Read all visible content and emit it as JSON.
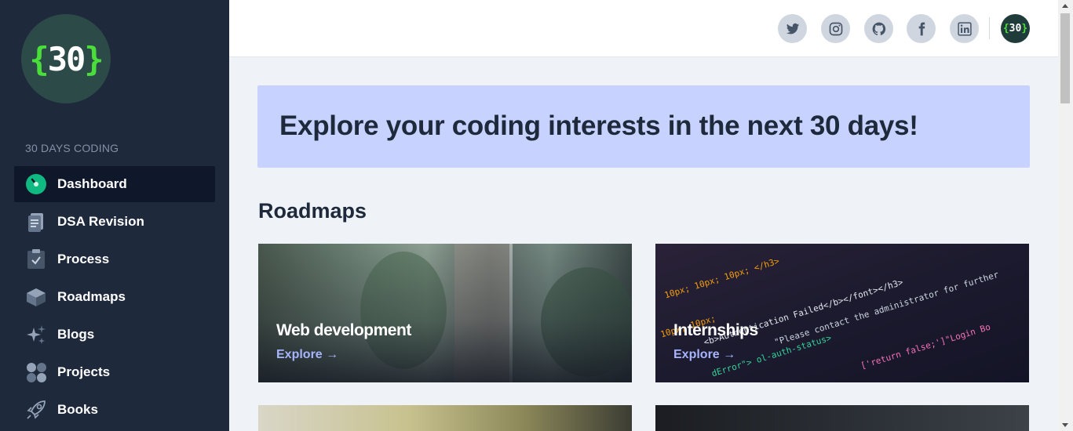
{
  "logo": {
    "open": "{",
    "number": "30",
    "close": "}"
  },
  "sidebar": {
    "section_label": "30 DAYS CODING",
    "items": [
      {
        "label": "Dashboard",
        "icon": "dashboard-icon",
        "active": true
      },
      {
        "label": "DSA Revision",
        "icon": "document-icon",
        "active": false
      },
      {
        "label": "Process",
        "icon": "clipboard-check-icon",
        "active": false
      },
      {
        "label": "Roadmaps",
        "icon": "cube-icon",
        "active": false
      },
      {
        "label": "Blogs",
        "icon": "sparkles-icon",
        "active": false
      },
      {
        "label": "Projects",
        "icon": "grid-dots-icon",
        "active": false
      },
      {
        "label": "Books",
        "icon": "rocket-icon",
        "active": false
      }
    ]
  },
  "header": {
    "social": [
      "twitter-icon",
      "instagram-icon",
      "github-icon",
      "facebook-icon",
      "linkedin-icon"
    ],
    "avatar": {
      "open": "{",
      "number": "30",
      "close": "}"
    }
  },
  "banner": {
    "title": "Explore your coding interests in the next 30 days!"
  },
  "roadmaps": {
    "title": "Roadmaps",
    "cards": [
      {
        "title": "Web development",
        "link": "Explore →"
      },
      {
        "title": "Internships",
        "link": "Explore →"
      }
    ]
  },
  "colors": {
    "sidebar_bg": "#1e293b",
    "active_bg": "#0f172a",
    "banner_bg": "#c7d2fe",
    "link": "#a5b4fc",
    "brand_green": "#4ade3a"
  }
}
